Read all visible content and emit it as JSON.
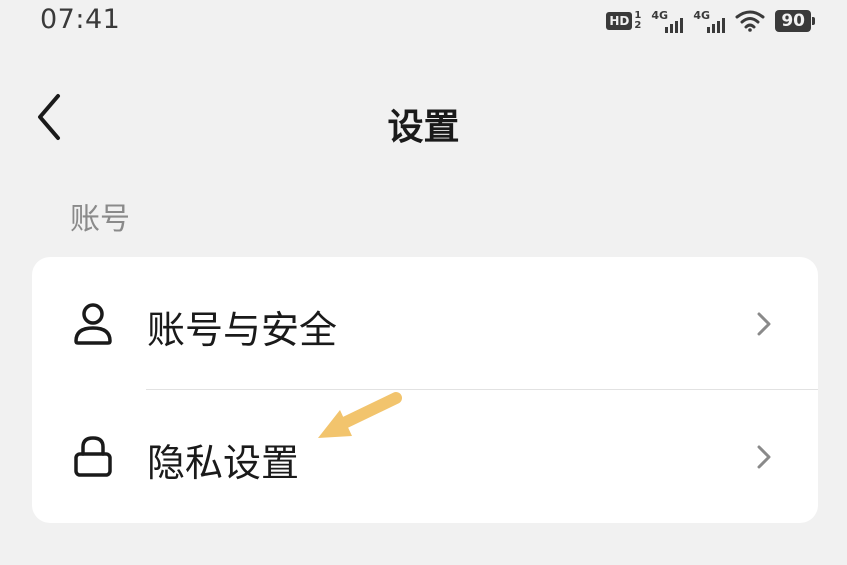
{
  "status_bar": {
    "time": "07:41",
    "hd_label": "HD",
    "sim_top": "1",
    "sim_bottom": "2",
    "signal1_label": "4G",
    "signal2_label": "4G",
    "battery": "90"
  },
  "header": {
    "title": "设置",
    "back_icon": "chevron-left-icon"
  },
  "section": {
    "label": "账号"
  },
  "settings": {
    "items": [
      {
        "label": "账号与安全",
        "icon": "user-icon"
      },
      {
        "label": "隐私设置",
        "icon": "lock-icon"
      }
    ]
  },
  "annotation": {
    "color": "#f2c46d"
  }
}
